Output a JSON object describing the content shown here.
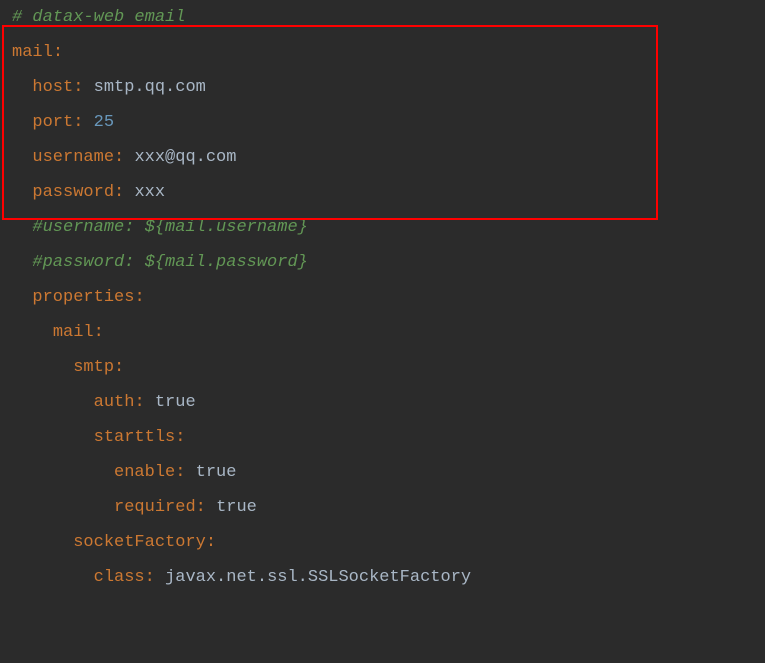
{
  "lines": {
    "comment1": "# datax-web email",
    "mail_key": "mail",
    "host_key": "host",
    "host_val": "smtp.qq.com",
    "port_key": "port",
    "port_val": "25",
    "username_key": "username",
    "username_val": "xxx@qq.com",
    "password_key": "password",
    "password_val": "xxx",
    "comment_user": "#username: ${mail.username}",
    "comment_pass": "#password: ${mail.password}",
    "properties_key": "properties",
    "mail2_key": "mail",
    "smtp_key": "smtp",
    "auth_key": "auth",
    "auth_val": "true",
    "starttls_key": "starttls",
    "enable_key": "enable",
    "enable_val": "true",
    "required_key": "required",
    "required_val": "true",
    "socketFactory_key": "socketFactory",
    "class_key": "class",
    "class_val": "javax.net.ssl.SSLSocketFactory"
  }
}
